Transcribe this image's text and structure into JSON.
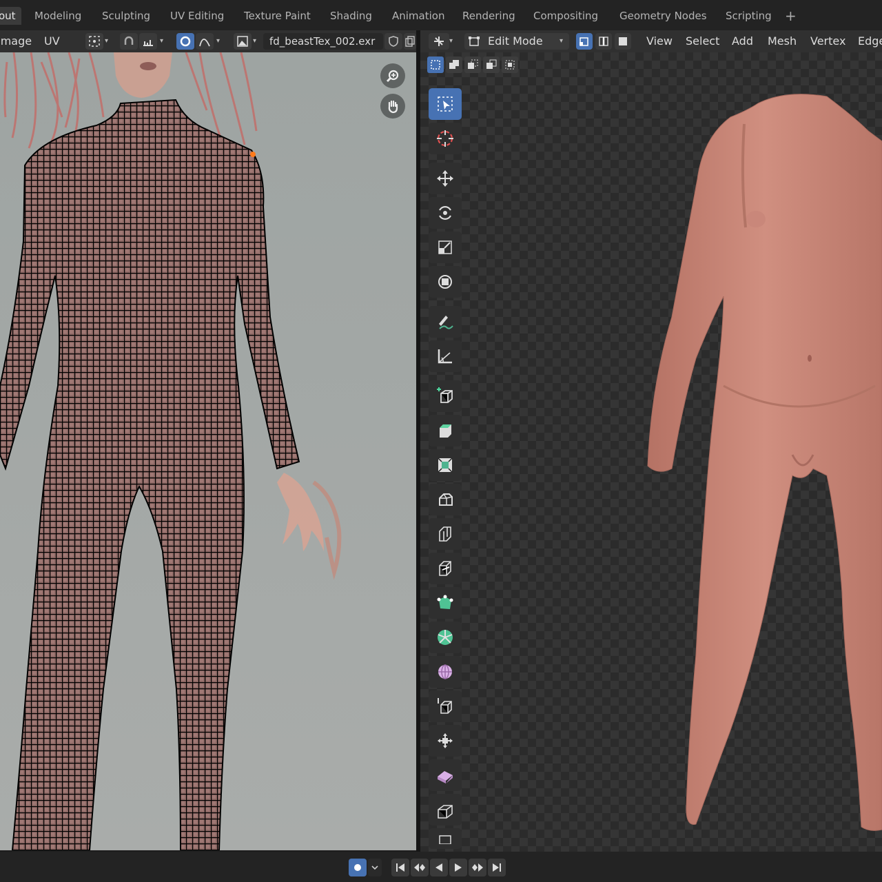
{
  "workspace_tabs": [
    "out",
    "Modeling",
    "Sculpting",
    "UV Editing",
    "Texture Paint",
    "Shading",
    "Animation",
    "Rendering",
    "Compositing",
    "Geometry Nodes",
    "Scripting"
  ],
  "active_tab": "out",
  "add_workspace": "+",
  "uv_header": {
    "menu_image": "Image",
    "menu_uv": "UV",
    "image_name": "fd_beastTex_002.exr"
  },
  "view3d_header": {
    "mode": "Edit Mode",
    "menus": [
      "View",
      "Select",
      "Add",
      "Mesh",
      "Vertex",
      "Edge"
    ]
  },
  "toolbar_tools": [
    "select-box",
    "cursor",
    "move",
    "rotate",
    "scale",
    "transform",
    "annotate",
    "measure",
    "add-cube",
    "extrude-region",
    "inset-faces",
    "bevel",
    "loop-cut",
    "knife",
    "poly-build",
    "spin",
    "smooth",
    "edge-slide",
    "shrink-fatten",
    "shear",
    "rip-region"
  ],
  "colors": {
    "accent": "#4772b3",
    "header": "#303030",
    "topbar": "#232323",
    "uv_background": "#a3a8a6",
    "skin": "#c7877a",
    "wire": "#000000"
  }
}
